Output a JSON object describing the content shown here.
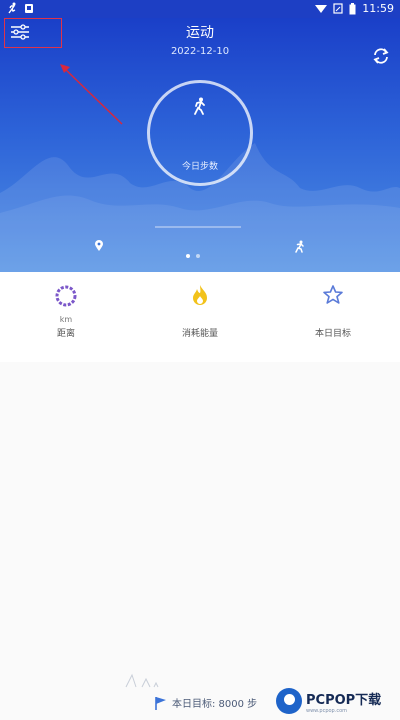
{
  "status_bar": {
    "time": "11:59"
  },
  "header": {
    "title": "运动",
    "date": "2022-12-10"
  },
  "ring": {
    "label": "今日步数"
  },
  "stats": [
    {
      "unit": "km",
      "label": "距离"
    },
    {
      "unit": "",
      "label": "消耗能量"
    },
    {
      "unit": "",
      "label": "本日目标"
    }
  ],
  "footer": {
    "goal_text": "本日目标: 8000 步"
  },
  "watermark": {
    "brand": "PCPOP下载",
    "sub": "www.pcpop.com"
  },
  "colors": {
    "accent": "#1d3fc4",
    "highlight": "#e0334a",
    "distance_ring": "#7b57c9",
    "energy": "#f2c21b",
    "star": "#5b7bd8"
  },
  "icons": [
    "settings-sliders-icon",
    "sync-icon",
    "runner-icon",
    "location-pin-icon",
    "flag-icon"
  ]
}
